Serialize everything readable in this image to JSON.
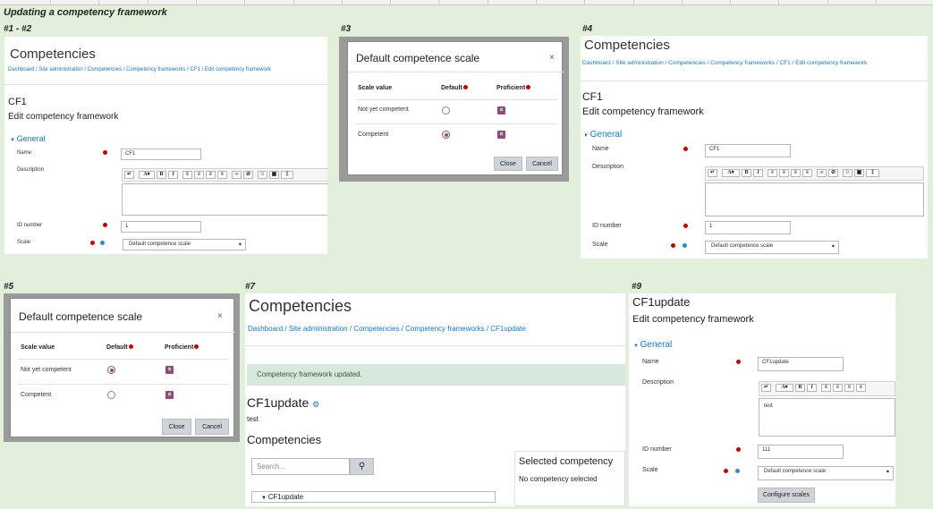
{
  "doc": {
    "title": "Updating a competency framework"
  },
  "labels": {
    "p12": "#1 - #2",
    "p3": "#3",
    "p4": "#4",
    "p5": "#5",
    "p7": "#7",
    "p9": "#9"
  },
  "framework": {
    "heading": "Competencies",
    "breadcrumb": [
      "Dashboard",
      "Site administration",
      "Competencies",
      "Competency frameworks",
      "CF1",
      "Edit competency framework"
    ],
    "name": "CF1",
    "subtitle": "Edit competency framework",
    "legend": "General",
    "name_label": "Name",
    "name_value": "CF1",
    "desc_label": "Description",
    "idnum_label": "ID number",
    "idnum_value": "1",
    "scale_label": "Scale",
    "scale_value": "Default competence scale"
  },
  "scale_modal": {
    "title": "Default competence scale",
    "close_x": "×",
    "col_value": "Scale value",
    "col_default": "Default",
    "col_proficient": "Proficient",
    "rows": [
      {
        "value": "Not yet competent"
      },
      {
        "value": "Competent"
      }
    ],
    "close_btn": "Close",
    "cancel_btn": "Cancel",
    "proficient_mark": "×"
  },
  "updated": {
    "heading": "Competencies",
    "breadcrumb": [
      "Dashboard",
      "Site administration",
      "Competencies",
      "Competency frameworks",
      "CF1update"
    ],
    "alert": "Competency framework updated.",
    "fw_name": "CF1update",
    "fw_desc": "test",
    "section": "Competencies",
    "search_placeholder": "Search...",
    "tree_item": "CF1update",
    "selected_title": "Selected competency",
    "selected_text": "No competency selected"
  },
  "edit9": {
    "name": "CF1update",
    "subtitle": "Edit competency framework",
    "legend": "General",
    "name_label": "Name",
    "name_value": "CF1update",
    "desc_label": "Description",
    "desc_value": "test",
    "idnum_label": "ID number",
    "idnum_value": "111",
    "scale_label": "Scale",
    "scale_value": "Default competence scale",
    "configure_btn": "Configure scales"
  },
  "colors": {
    "background": "#e2efda",
    "link": "#1177d1",
    "required": "#cc0000",
    "mark": "#8e4b7a",
    "alert": "#d7e9dc"
  }
}
